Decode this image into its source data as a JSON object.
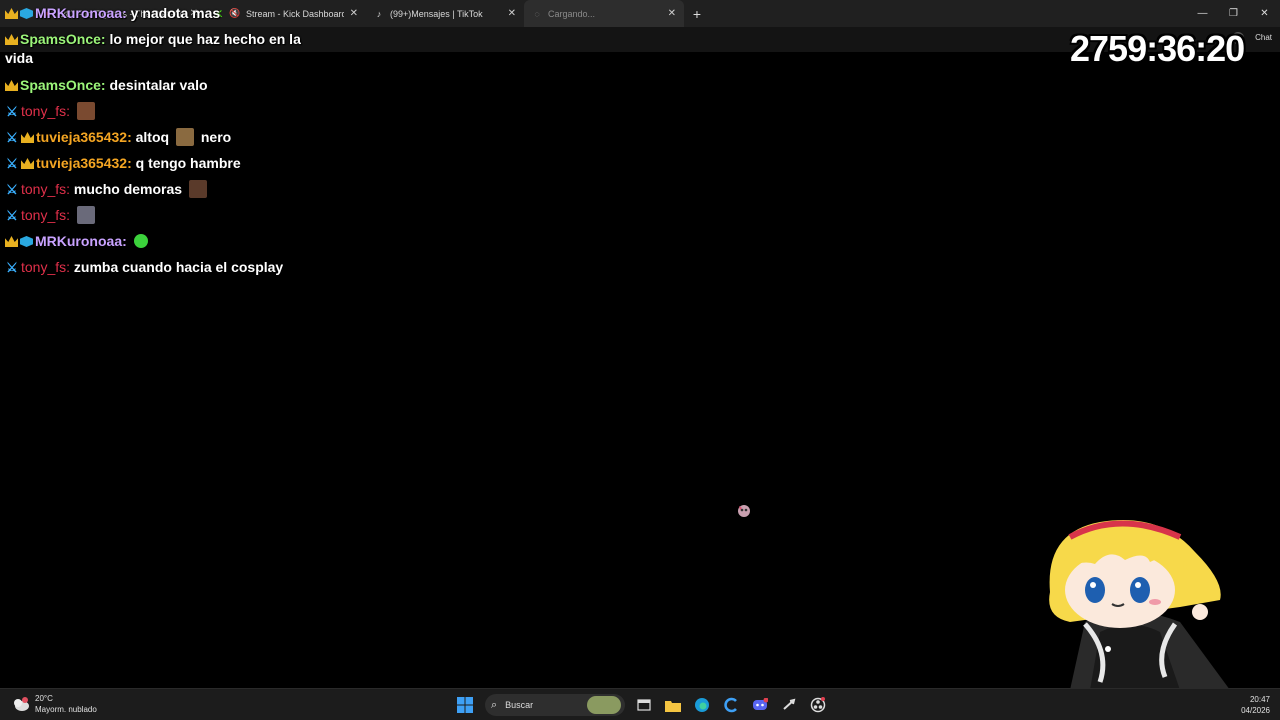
{
  "browser": {
    "tabs": [
      {
        "label": "(28) Foo Fighters - The Pretend...",
        "icon": "youtube-icon"
      },
      {
        "label": "Stream - Kick Dashboard",
        "icon": "kick-icon"
      },
      {
        "label": "(99+)Mensajes | TikTok",
        "icon": "tiktok-icon"
      },
      {
        "label": "Cargando...",
        "icon": "loading-icon"
      }
    ],
    "new_tab": "+",
    "chat_button": "Chat"
  },
  "chat": {
    "messages": [
      {
        "user": "MRKuronoaa:",
        "text": "y nadota mas",
        "badges": [
          "crown",
          "cube"
        ]
      },
      {
        "user": "SpamsOnce:",
        "text": "lo mejor que haz hecho en la vida",
        "badges": [
          "crown"
        ]
      },
      {
        "user": "SpamsOnce:",
        "text": "desintalar valo",
        "badges": [
          "crown"
        ]
      },
      {
        "user": "tony_fs:",
        "text": "",
        "badges": [
          "sword"
        ]
      },
      {
        "user": "tuvieja365432:",
        "text": "altoq",
        "text2": "nero",
        "badges": [
          "sword",
          "crown"
        ]
      },
      {
        "user": "tuvieja365432:",
        "text": "q tengo hambre",
        "badges": [
          "sword",
          "crown"
        ]
      },
      {
        "user": "tony_fs:",
        "text": "mucho demoras",
        "badges": [
          "sword"
        ]
      },
      {
        "user": "tony_fs:",
        "text": "",
        "badges": [
          "sword"
        ]
      },
      {
        "user": "MRKuronoaa:",
        "text": "",
        "badges": [
          "crown",
          "cube"
        ]
      },
      {
        "user": "tony_fs:",
        "text": "zumba cuando hacia el cosplay",
        "badges": [
          "sword"
        ]
      }
    ]
  },
  "timer": "2759:36:20",
  "taskbar": {
    "weather_temp": "20°C",
    "weather_desc": "Mayorm. nublado",
    "search_label": "Buscar",
    "time": "20:47",
    "date": "04/2026"
  },
  "colors": {
    "mrkuronoaa": "#c9a2ff",
    "spamsonce": "#9cf57a",
    "tony": "#e0304a",
    "tuvieja": "#f5a623"
  }
}
